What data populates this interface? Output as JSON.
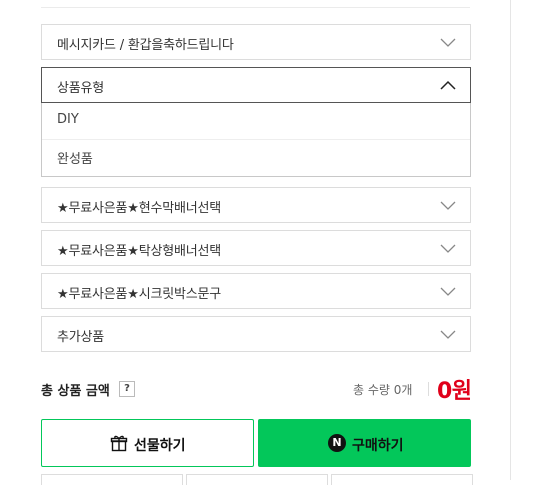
{
  "options": {
    "message_card": "메시지카드 / 환갑을축하드립니다",
    "product_type": "상품유형",
    "product_type_options": [
      "DIY",
      "완성품"
    ],
    "gift1": "★무료사은품★현수막배너선택",
    "gift2": "★무료사은품★탁상형배너선택",
    "gift3": "★무료사은품★시크릿박스문구",
    "extra": "추가상품"
  },
  "summary": {
    "total_label": "총 상품 금액",
    "help": "?",
    "quantity": "총 수량 0개",
    "price": "0원"
  },
  "actions": {
    "gift_label": "선물하기",
    "buy_label": "구매하기",
    "buy_icon_letter": "N"
  },
  "colors": {
    "accent": "#03c75a",
    "price": "#e0001a"
  }
}
